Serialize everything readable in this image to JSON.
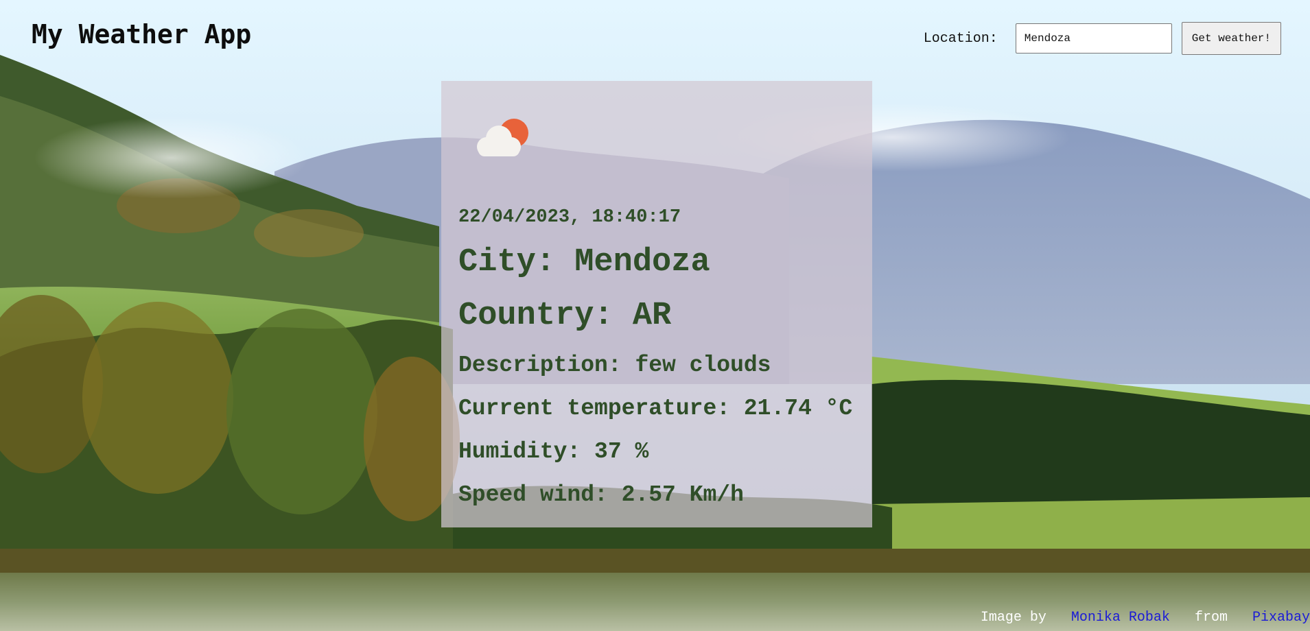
{
  "header": {
    "title": "My Weather App"
  },
  "search": {
    "label": "Location:",
    "value": "Mendoza",
    "button_label": "Get weather!"
  },
  "weather": {
    "icon": "few-clouds-day-icon",
    "datetime": "22/04/2023, 18:40:17",
    "city": "City: Mendoza",
    "country": "Country: AR",
    "description": "Description: few clouds",
    "temperature": "Current temperature: 21.74 °C",
    "humidity": "Humidity: 37 %",
    "wind": "Speed wind: 2.57 Km/h"
  },
  "credits": {
    "prefix": "Image by",
    "author": "Monika Robak",
    "middle": "from",
    "source": "Pixabay"
  },
  "colors": {
    "card_text": "#2f4e28",
    "card_background": "rgba(210,200,210,0.72)",
    "link": "#1b1bd6",
    "sun": "#e8623a"
  }
}
